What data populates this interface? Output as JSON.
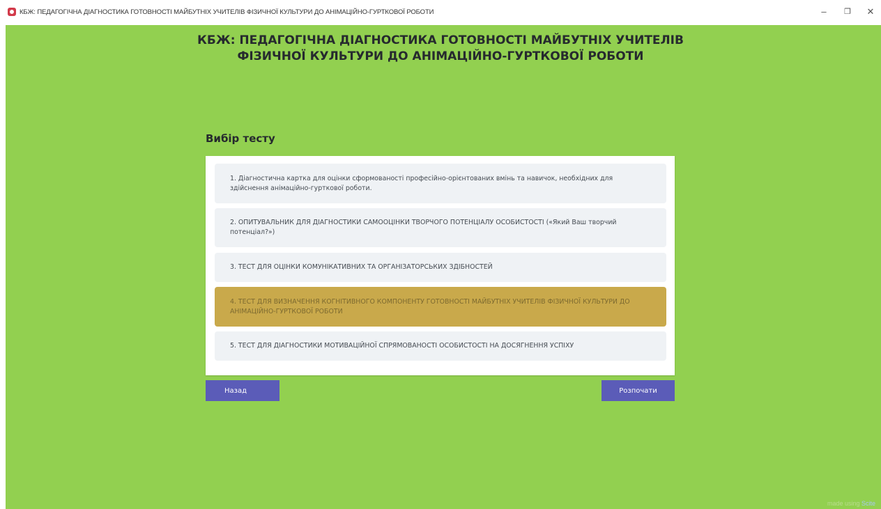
{
  "window": {
    "title": "КБЖ: ПЕДАГОГІЧНА ДІАГНОСТИКА ГОТОВНОСТІ МАЙБУТНІХ УЧИТЕЛІВ ФІЗИЧНОЇ КУЛЬТУРИ ДО АНІМАЦІЙНО-ГУРТКОВОЇ РОБОТИ",
    "icon": "app-shield-icon",
    "controls": {
      "minimize": "–",
      "restore": "❐",
      "close": "✕"
    }
  },
  "header": {
    "title_line1": "КБЖ: ПЕДАГОГІЧНА ДІАГНОСТИКА ГОТОВНОСТІ МАЙБУТНІХ УЧИТЕЛІВ",
    "title_line2": "ФІЗИЧНОЇ КУЛЬТУРИ ДО АНІМАЦІЙНО-ГУРТКОВОЇ РОБОТИ"
  },
  "section": {
    "heading": "Вибір тесту"
  },
  "tests": [
    {
      "label": "1. Діагностична картка для оцінки сформованості професійно-орієнтованих вмінь та навичок, необхідних для здійснення анімаційно-гурткової роботи.",
      "selected": false
    },
    {
      "label": "2. ОПИТУВАЛЬНИК ДЛЯ ДІАГНОСТИКИ САМООЦІНКИ ТВОРЧОГО ПОТЕНЦІАЛУ ОСОБИСТОСТІ («Який Ваш творчий потенціал?»)",
      "selected": false
    },
    {
      "label": "3. ТЕСТ ДЛЯ ОЦІНКИ КОМУНІКАТИВНИХ ТА ОРГАНІЗАТОРСЬКИХ ЗДІБНОСТЕЙ",
      "selected": false
    },
    {
      "label": "4. ТЕСТ ДЛЯ ВИЗНАЧЕННЯ КОГНІТИВНОГО КОМПОНЕНТУ ГОТОВНОСТІ МАЙБУТНІХ УЧИТЕЛІВ ФІЗИЧНОЇ КУЛЬТУРИ ДО АНІМАЦІЙНО-ГУРТКОВОЇ РОБОТИ",
      "selected": true
    },
    {
      "label": "5. ТЕСТ ДЛЯ ДІАГНОСТИКИ МОТИВАЦІЙНОЇ СПРЯМОВАНОСТІ ОСОБИСТОСТІ НА ДОСЯГНЕННЯ УСПІХУ",
      "selected": false
    }
  ],
  "buttons": {
    "back": "Назад",
    "start": "Розпочати"
  },
  "footer": {
    "credit_prefix": "made using ",
    "credit_link": "Scite"
  },
  "colors": {
    "background": "#92d050",
    "selected_item": "#c9a94b",
    "item": "#eff2f5",
    "button": "#5b5cb8"
  }
}
